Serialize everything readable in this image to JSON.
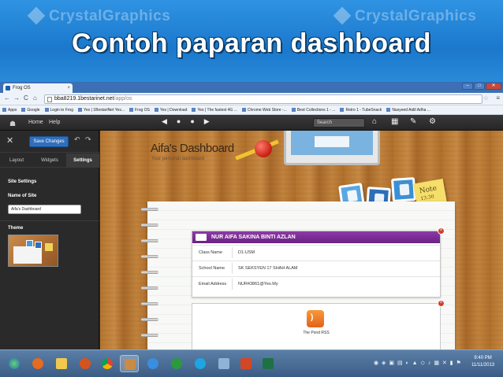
{
  "slide": {
    "watermark": "CrystalGraphics",
    "title": "Contoh paparan dashboard"
  },
  "browser": {
    "tab_title": "Frog OS",
    "tab_close": "×",
    "url_host": "bba8219.1bestarinet.net",
    "url_path": "/app/os",
    "bookmarks": [
      "Apps",
      "Google",
      "Login to Frog",
      "Yes | 1BestariNet Yes...",
      "Frog OS",
      "Yes | Download",
      "Yes | The fastest 4G ...",
      "Chrome Web Store -...",
      "Best Collections 1 - ...",
      "Retro 1 - TubeSnack",
      "Nasyeed Aidil Adha ..."
    ]
  },
  "app": {
    "nav": {
      "home": "Home",
      "help": "Help",
      "search_placeholder": "Search"
    },
    "sidebar": {
      "save_label": "Save Changes",
      "tabs": [
        "Layout",
        "Widgets",
        "Settings"
      ],
      "site_settings": "Site Settings",
      "name_of_site_label": "Name of Site",
      "site_name_value": "Aifa's Dashboard",
      "theme_label": "Theme"
    },
    "dashboard": {
      "title": "Aifa's Dashboard",
      "subtitle": "Your personal dashboard",
      "note_text": "Note",
      "note_time": "13:30",
      "student": {
        "name": "NUR AIFA SAKINA BINTI AZLAN",
        "rows": [
          {
            "label": "Class Name",
            "value": "D1-USM"
          },
          {
            "label": "School Name",
            "value": "SK SEKSYEN 17 SHAH ALAM"
          },
          {
            "label": "Email Address",
            "value": "NUR43861@Yes.My"
          }
        ]
      },
      "rss_label": "The Pond RSS"
    }
  },
  "taskbar": {
    "clock_time": "9:40 PM",
    "clock_date": "11/11/2013"
  }
}
